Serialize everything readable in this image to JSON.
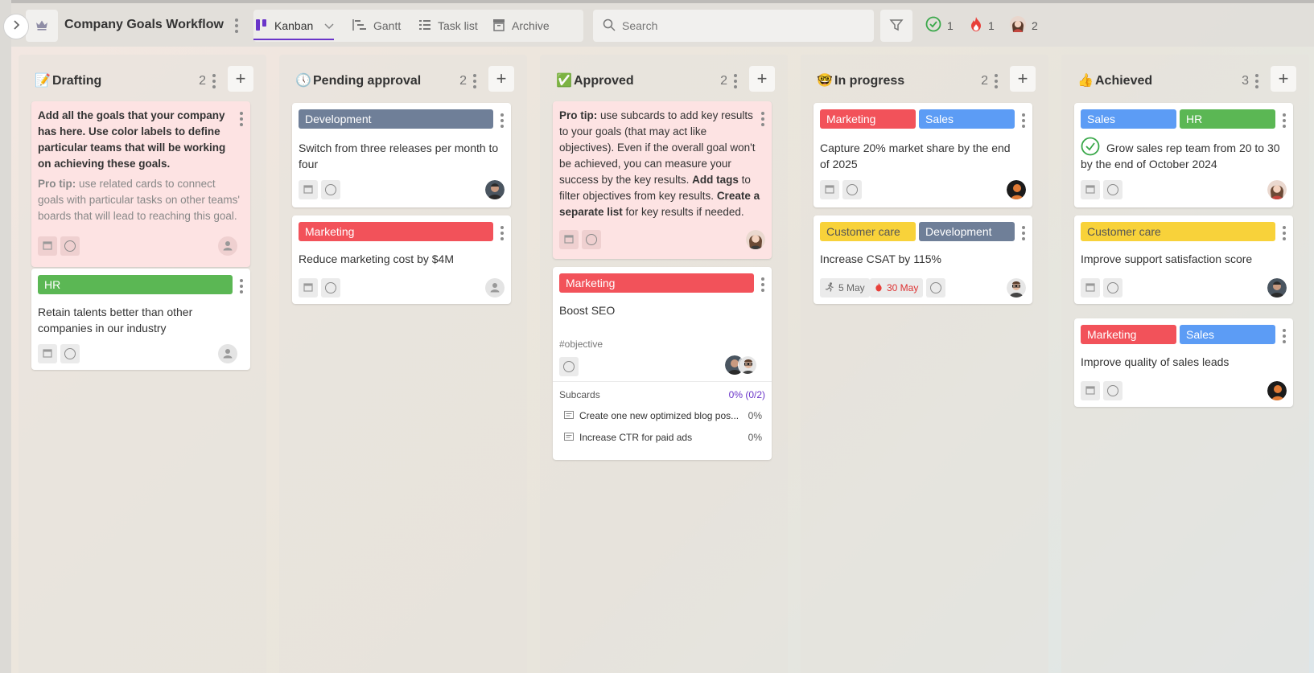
{
  "colors": {
    "accent": "#6a35c9",
    "tag_development": "#6f7f98",
    "tag_marketing": "#f2525a",
    "tag_sales": "#5c9cf5",
    "tag_hr": "#5bb754",
    "tag_customer_care": "#f8d23a",
    "tip_card": "#fde3e3"
  },
  "header": {
    "board_title": "Company Goals Workflow",
    "tabs": [
      {
        "label": "Kanban",
        "icon": "kanban-icon",
        "active": true
      },
      {
        "label": "Gantt",
        "icon": "gantt-icon"
      },
      {
        "label": "Task list",
        "icon": "list-icon"
      },
      {
        "label": "Archive",
        "icon": "archive-icon"
      }
    ],
    "search_placeholder": "Search",
    "stats": {
      "completed": "1",
      "urgent": "1",
      "members": "2"
    }
  },
  "columns": [
    {
      "title": "Drafting",
      "emoji": "📝",
      "count": "2",
      "cards": [
        {
          "tip_bold": "Add all the goals that your company has here. Use color labels to define particular teams that will be working on achieving these goals.",
          "tip_label": "Pro tip:",
          "tip_text": " use related cards to connect goals with particular tasks on other teams' boards that will lead to reaching this goal."
        },
        {
          "tags": [
            "HR"
          ],
          "title": "Retain talents better than other companies in our industry"
        }
      ]
    },
    {
      "title": "Pending approval",
      "emoji": "🕔",
      "count": "2",
      "cards": [
        {
          "tags": [
            "Development"
          ],
          "title": "Switch from three releases per month to four"
        },
        {
          "tags": [
            "Marketing"
          ],
          "title": "Reduce marketing cost by $4M"
        }
      ]
    },
    {
      "title": "Approved",
      "emoji": "✅",
      "count": "2",
      "cards": [
        {
          "p1": "Pro tip:",
          "p2": " use subcards to add key results to your goals (that may act like objectives). Even if the overall goal won't be achieved, you can measure your success by the key results. ",
          "p3": "Add tags",
          "p4": " to filter objectives from key results. ",
          "p5": "Create a separate list",
          "p6": " for key results if needed."
        },
        {
          "tags": [
            "Marketing"
          ],
          "title": "Boost SEO",
          "hashtag": "#objective",
          "subcards_label": "Subcards",
          "subcards_progress": "0% (0/2)",
          "subcards": [
            {
              "title": "Create one new optimized blog pos...",
              "pct": "0%"
            },
            {
              "title": "Increase CTR for paid ads",
              "pct": "0%"
            }
          ]
        }
      ]
    },
    {
      "title": "In progress",
      "emoji": "🤓",
      "count": "2",
      "cards": [
        {
          "tags": [
            "Marketing",
            "Sales"
          ],
          "title": "Capture 20% market share by the end of 2025"
        },
        {
          "tags": [
            "Customer care",
            "Development"
          ],
          "title": "Increase CSAT by 115%",
          "start_date": "5 May",
          "due_date": "30 May"
        }
      ]
    },
    {
      "title": "Achieved",
      "emoji": "👍",
      "count": "3",
      "cards": [
        {
          "tags": [
            "Sales",
            "HR"
          ],
          "title": "Grow sales rep team from  20 to 30 by the end of October 2024"
        },
        {
          "tags": [
            "Customer care"
          ],
          "title": "Improve support satisfaction score"
        },
        {
          "tags": [
            "Marketing",
            "Sales"
          ],
          "title": "Improve quality of sales leads"
        }
      ]
    }
  ]
}
